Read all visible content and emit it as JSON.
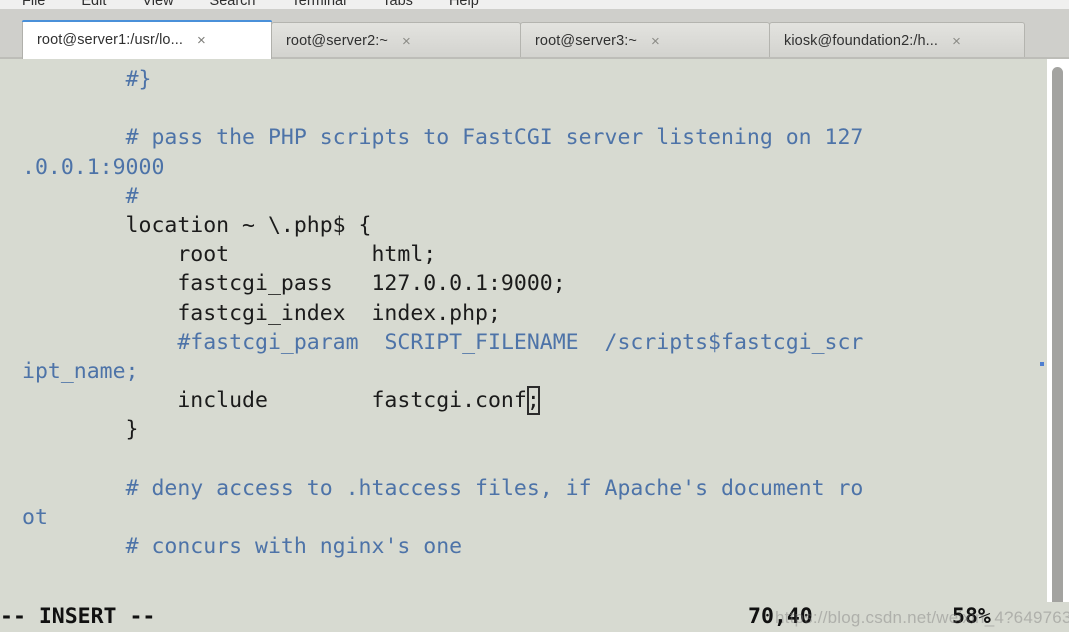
{
  "window": {
    "app": "gnome-terminal",
    "background_color": "#d7dad1",
    "comment_color": "#4d73a8",
    "accent_color": "#4a90d9"
  },
  "menubar": {
    "items": [
      {
        "label": "File"
      },
      {
        "label": "Edit"
      },
      {
        "label": "View"
      },
      {
        "label": "Search"
      },
      {
        "label": "Terminal"
      },
      {
        "label": "Tabs"
      },
      {
        "label": "Help"
      }
    ]
  },
  "tabs": [
    {
      "label": "root@server1:/usr/lo...",
      "close": "×",
      "active": true
    },
    {
      "label": "root@server2:~",
      "close": "×",
      "active": false
    },
    {
      "label": "root@server3:~",
      "close": "×",
      "active": false
    },
    {
      "label": "kiosk@foundation2:/h...",
      "close": "×",
      "active": false
    }
  ],
  "terminal": {
    "lines": [
      {
        "segments": [
          {
            "text": "        ",
            "type": "plain"
          },
          {
            "text": "#}",
            "type": "comment"
          }
        ]
      },
      {
        "segments": [
          {
            "text": "",
            "type": "plain"
          }
        ]
      },
      {
        "segments": [
          {
            "text": "        ",
            "type": "plain"
          },
          {
            "text": "# pass the PHP scripts to FastCGI server listening on 127",
            "type": "comment"
          }
        ]
      },
      {
        "segments": [
          {
            "text": ".0.0.1:9000",
            "type": "comment"
          }
        ]
      },
      {
        "segments": [
          {
            "text": "        ",
            "type": "plain"
          },
          {
            "text": "#",
            "type": "comment"
          }
        ]
      },
      {
        "segments": [
          {
            "text": "        location ~ \\.php$ {",
            "type": "plain"
          }
        ]
      },
      {
        "segments": [
          {
            "text": "            root           html;",
            "type": "plain"
          }
        ]
      },
      {
        "segments": [
          {
            "text": "            fastcgi_pass   127.0.0.1:9000;",
            "type": "plain"
          }
        ]
      },
      {
        "segments": [
          {
            "text": "            fastcgi_index  index.php;",
            "type": "plain"
          }
        ]
      },
      {
        "segments": [
          {
            "text": "            ",
            "type": "plain"
          },
          {
            "text": "#fastcgi_param  SCRIPT_FILENAME  /scripts$fastcgi_scr",
            "type": "comment"
          }
        ]
      },
      {
        "segments": [
          {
            "text": "ipt_name;",
            "type": "comment"
          }
        ]
      },
      {
        "segments": [
          {
            "text": "            include        fastcgi.conf",
            "type": "plain"
          },
          {
            "text": ";",
            "type": "cursor"
          }
        ]
      },
      {
        "segments": [
          {
            "text": "        }",
            "type": "plain"
          }
        ]
      },
      {
        "segments": [
          {
            "text": "",
            "type": "plain"
          }
        ]
      },
      {
        "segments": [
          {
            "text": "        ",
            "type": "plain"
          },
          {
            "text": "# deny access to .htaccess files, if Apache's document ro",
            "type": "comment"
          }
        ]
      },
      {
        "segments": [
          {
            "text": "ot",
            "type": "comment"
          }
        ]
      },
      {
        "segments": [
          {
            "text": "        ",
            "type": "plain"
          },
          {
            "text": "# concurs with nginx's one",
            "type": "comment"
          }
        ]
      }
    ]
  },
  "statusline": {
    "mode": "-- INSERT --",
    "position": "70,40",
    "percent": "58%"
  },
  "watermark": {
    "text": "https://blog.csdn.net/weixin_4?649763"
  },
  "scrollbar": {
    "name": "vertical-scrollbar"
  }
}
